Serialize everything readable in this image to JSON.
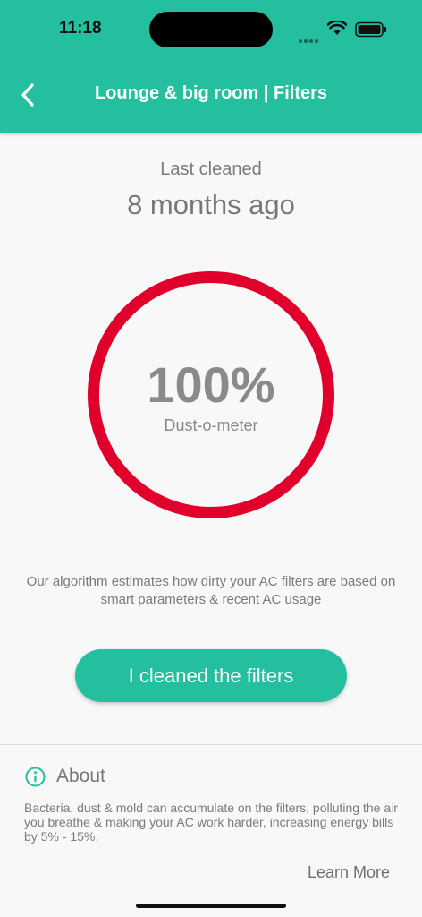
{
  "status_bar": {
    "time": "11:18"
  },
  "header": {
    "title": "Lounge & big room | Filters",
    "back_icon": "chevron-left-icon"
  },
  "last_cleaned": {
    "label": "Last cleaned",
    "value": "8 months ago"
  },
  "dust_meter": {
    "value": "100%",
    "label": "Dust-o-meter",
    "percent": 100,
    "color": "#e0002b"
  },
  "description": "Our algorithm estimates how dirty your AC filters are based on smart parameters & recent AC usage",
  "action": {
    "label": "I cleaned the filters"
  },
  "about": {
    "title": "About",
    "icon": "info-icon",
    "text": "Bacteria, dust & mold can accumulate on the filters, polluting the air you breathe & making your AC work harder, increasing energy bills by 5% - 15%.",
    "link": "Learn More"
  },
  "colors": {
    "primary": "#24bf9f",
    "gauge": "#e0002b",
    "background": "#f8f8f8"
  }
}
